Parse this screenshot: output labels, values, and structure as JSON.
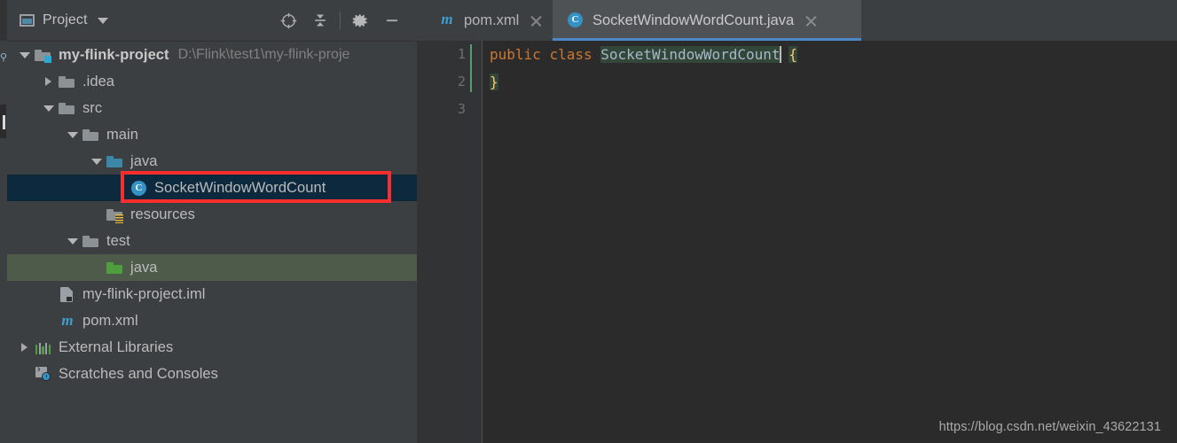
{
  "window": {
    "theme_bg": "#2b2b2b",
    "panel_bg": "#3c3f41"
  },
  "project_panel": {
    "title": "Project",
    "title_icon": "project-window-icon",
    "dropdown_icon": "chevron-down-icon",
    "tools": [
      {
        "name": "select-opened-file-icon",
        "label": "Select Opened File"
      },
      {
        "name": "collapse-all-icon",
        "label": "Collapse All"
      },
      {
        "name": "settings-gear-icon",
        "label": "Settings"
      },
      {
        "name": "hide-panel-icon",
        "label": "Hide"
      }
    ],
    "tree": [
      {
        "label": "my-flink-project",
        "path": "D:\\Flink\\test1\\my-flink-proje",
        "icon": "module-folder-icon",
        "twisty": "open",
        "depth": 0,
        "bold": true,
        "state": "normal"
      },
      {
        "label": ".idea",
        "icon": "folder-icon",
        "twisty": "closed",
        "depth": 1,
        "bold": false,
        "state": "normal"
      },
      {
        "label": "src",
        "icon": "folder-icon",
        "twisty": "open",
        "depth": 1,
        "bold": false,
        "state": "normal"
      },
      {
        "label": "main",
        "icon": "folder-icon",
        "twisty": "open",
        "depth": 2,
        "bold": false,
        "state": "normal"
      },
      {
        "label": "java",
        "icon": "source-folder-icon",
        "twisty": "open",
        "depth": 3,
        "bold": false,
        "state": "normal"
      },
      {
        "label": "SocketWindowWordCount",
        "icon": "java-class-icon",
        "icon_letter": "C",
        "twisty": "none",
        "depth": 4,
        "bold": false,
        "state": "selected"
      },
      {
        "label": "resources",
        "icon": "resources-folder-icon",
        "twisty": "none",
        "depth": 3,
        "bold": false,
        "state": "normal"
      },
      {
        "label": "test",
        "icon": "folder-icon",
        "twisty": "open",
        "depth": 2,
        "bold": false,
        "state": "normal"
      },
      {
        "label": "java",
        "icon": "test-source-folder-icon",
        "twisty": "none",
        "depth": 3,
        "bold": false,
        "state": "test-source"
      },
      {
        "label": "my-flink-project.iml",
        "icon": "iml-file-icon",
        "twisty": "none",
        "depth": 1,
        "bold": false,
        "state": "normal"
      },
      {
        "label": "pom.xml",
        "icon": "maven-file-icon",
        "icon_letter": "m",
        "twisty": "none",
        "depth": 1,
        "bold": false,
        "state": "normal"
      },
      {
        "label": "External Libraries",
        "icon": "external-libraries-icon",
        "twisty": "closed",
        "depth": 0,
        "bold": false,
        "state": "normal"
      },
      {
        "label": "Scratches and Consoles",
        "icon": "scratches-consoles-icon",
        "twisty": "none",
        "depth": 0,
        "bold": false,
        "state": "normal"
      }
    ],
    "annotation": {
      "name": "red-highlight-box",
      "color": "#fb2e2e"
    }
  },
  "editor": {
    "tabs": [
      {
        "label": "pom.xml",
        "icon": "maven-file-icon",
        "icon_letter": "m",
        "active": false,
        "close_icon": "close-icon"
      },
      {
        "label": "SocketWindowWordCount.java",
        "icon": "java-class-icon",
        "icon_letter": "C",
        "active": true,
        "close_icon": "close-icon"
      }
    ],
    "active_tab_underline_color": "#4a88c7",
    "gutter": {
      "line_numbers": [
        "1",
        "2",
        "3"
      ],
      "vcs_change_color": "#5a9e6f"
    },
    "code": {
      "line1": {
        "keyword1": "public",
        "keyword2": "class",
        "identifier": "SocketWindowWordCount",
        "open_brace": "{"
      },
      "line2": {
        "close_brace": "}"
      },
      "line3": {
        "text": ""
      }
    },
    "syntax_colors": {
      "keyword": "#cc7832",
      "identifier": "#a9b7c6",
      "brace": "#ffc66d",
      "highlight_bg": "#32473a"
    }
  },
  "watermark": {
    "text": "https://blog.csdn.net/weixin_43622131"
  }
}
